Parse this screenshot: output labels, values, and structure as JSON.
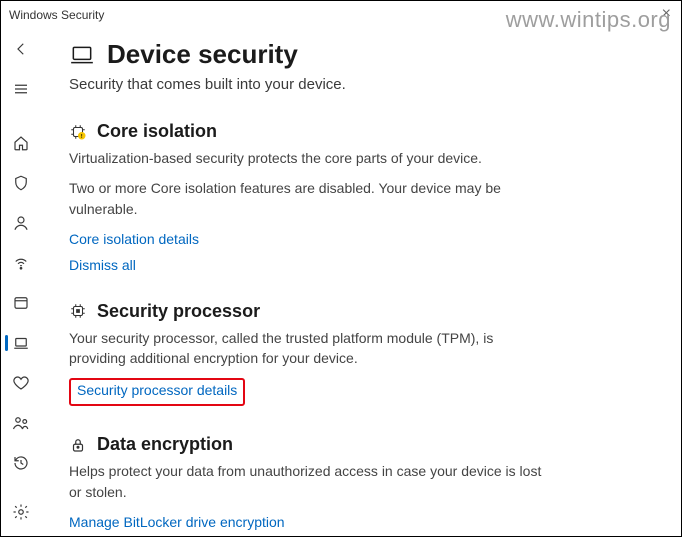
{
  "window": {
    "title": "Windows Security"
  },
  "watermark": "www.wintips.org",
  "page": {
    "title": "Device security",
    "subtitle": "Security that comes built into your device."
  },
  "sections": {
    "core": {
      "heading": "Core isolation",
      "desc": "Virtualization-based security protects the core parts of your device.",
      "warn": "Two or more Core isolation features are disabled.  Your device may be vulnerable.",
      "link_details": "Core isolation details",
      "link_dismiss": "Dismiss all"
    },
    "tpm": {
      "heading": "Security processor",
      "desc": "Your security processor, called the trusted platform module (TPM), is providing additional encryption for your device.",
      "link": "Security processor details"
    },
    "enc": {
      "heading": "Data encryption",
      "desc": "Helps protect your data from unauthorized access in case your device is lost or stolen.",
      "link": "Manage BitLocker drive encryption"
    }
  }
}
